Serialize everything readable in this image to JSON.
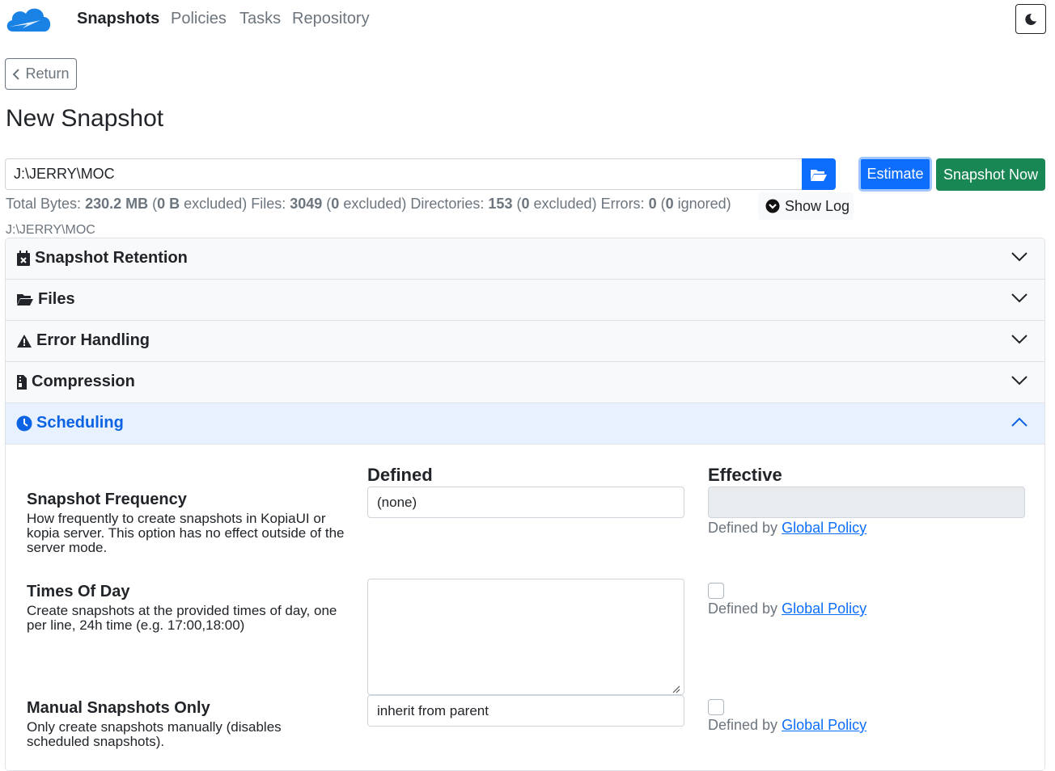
{
  "nav": {
    "links": [
      "Snapshots",
      "Policies",
      "Tasks",
      "Repository"
    ],
    "logo_icon": "kopia-cloud-logo",
    "theme_icon": "moon-icon"
  },
  "return_label": "Return",
  "title": "New Snapshot",
  "path": {
    "value": "J:\\JERRY\\MOC",
    "browse_icon": "folder-open-icon"
  },
  "buttons": {
    "estimate": "Estimate",
    "snapshot_now": "Snapshot Now"
  },
  "stats": {
    "total_bytes_label": "Total Bytes:",
    "total_bytes": "230.2 MB",
    "bytes_excluded": "0 B",
    "files_label": "Files:",
    "files": "3049",
    "files_excluded": "0",
    "dirs_label": "Directories:",
    "dirs": "153",
    "dirs_excluded": "0",
    "errors_label": "Errors:",
    "errors": "0",
    "errors_ignored": "0",
    "excluded_word": "excluded)",
    "ignored_word": "ignored)"
  },
  "show_log": "Show Log",
  "path_caption": "J:\\JERRY\\MOC",
  "accordion": [
    {
      "label": "Snapshot Retention",
      "icon": "calendar-x-icon",
      "open": false
    },
    {
      "label": "Files",
      "icon": "folder-open-icon",
      "open": false
    },
    {
      "label": "Error Handling",
      "icon": "warning-icon",
      "open": false
    },
    {
      "label": "Compression",
      "icon": "file-zipper-icon",
      "open": false
    },
    {
      "label": "Scheduling",
      "icon": "clock-icon",
      "open": true
    }
  ],
  "scheduling": {
    "col_defined": "Defined",
    "col_effective": "Effective",
    "defined_by": "Defined by",
    "global_policy": "Global Policy",
    "rows": [
      {
        "label": "Snapshot Frequency",
        "help": "How frequently to create snapshots in KopiaUI or kopia server. This option has no effect outside of the server mode.",
        "value": "(none)"
      },
      {
        "label": "Times Of Day",
        "help": "Create snapshots at the provided times of day, one per line, 24h time (e.g. 17:00,18:00)",
        "value": ""
      },
      {
        "label": "Manual Snapshots Only",
        "help": "Only create snapshots manually (disables scheduled snapshots).",
        "value": "inherit from parent"
      }
    ]
  },
  "colors": {
    "primary": "#0d6efd",
    "success": "#198754",
    "muted": "#6c757d"
  }
}
